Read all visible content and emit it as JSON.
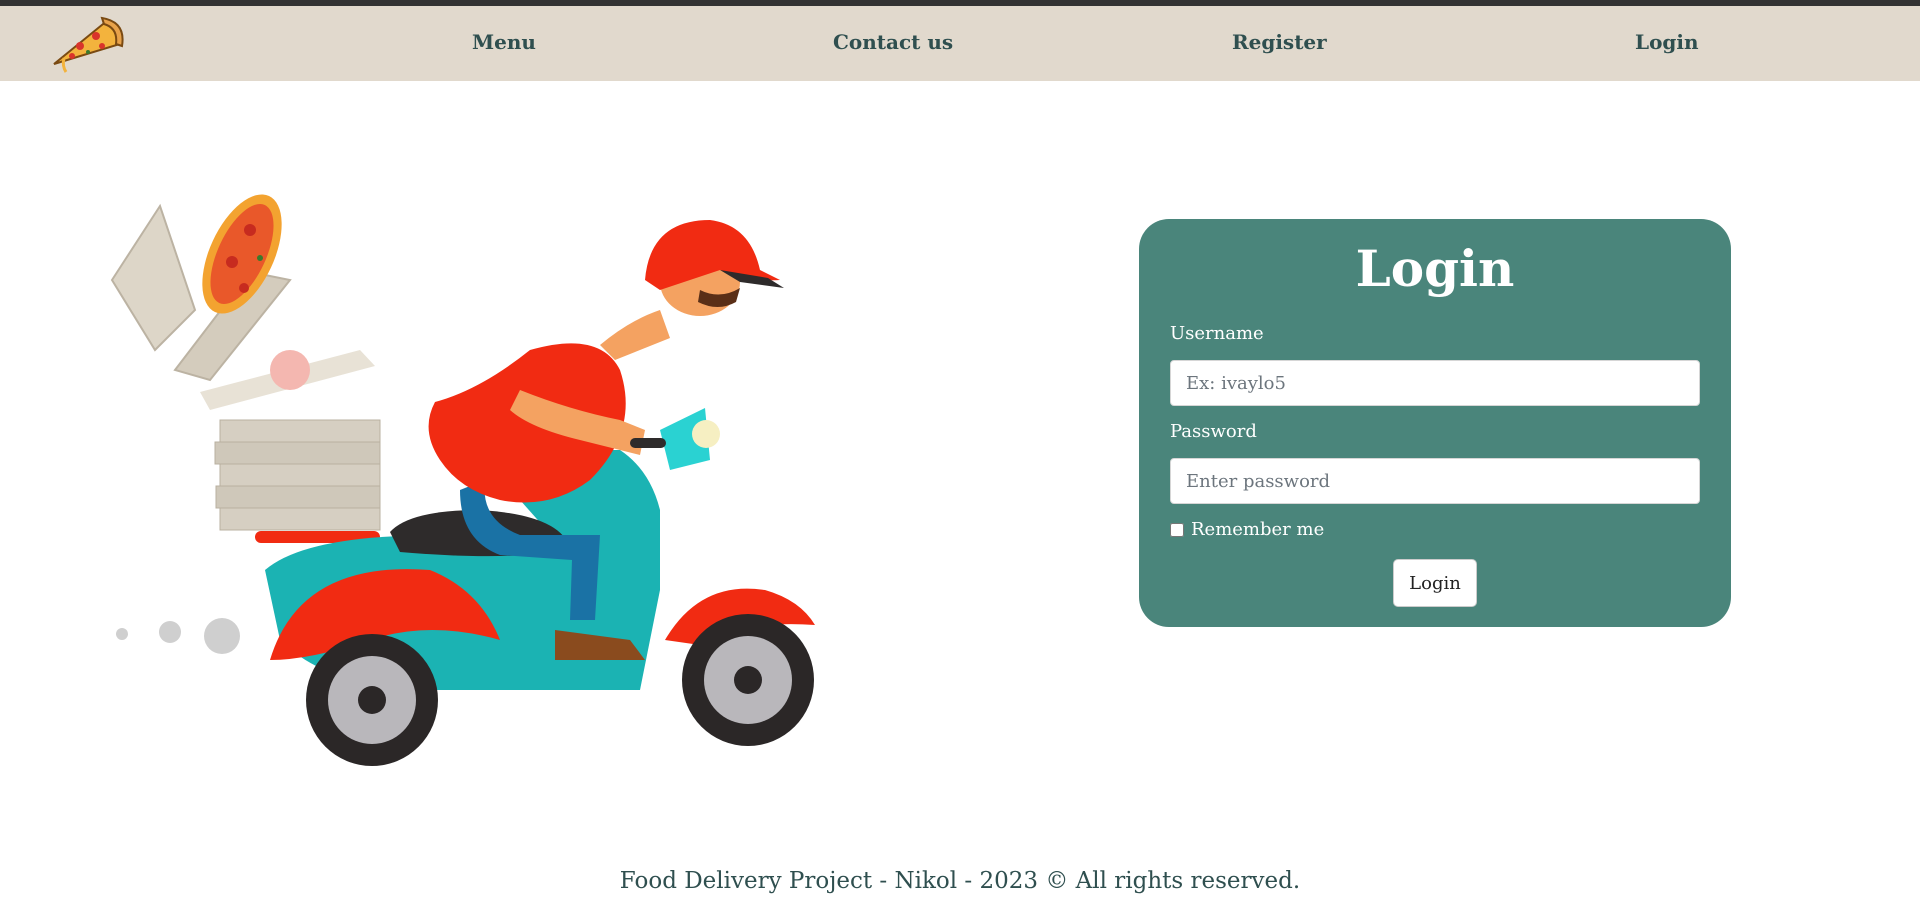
{
  "nav": {
    "items": [
      {
        "label": "Menu"
      },
      {
        "label": "Contact us"
      },
      {
        "label": "Register"
      },
      {
        "label": "Login"
      }
    ]
  },
  "login_form": {
    "title": "Login",
    "username_label": "Username",
    "username_placeholder": "Ex: ivaylo5",
    "password_label": "Password",
    "password_placeholder": "Enter password",
    "remember_label": "Remember me",
    "submit_label": "Login"
  },
  "footer": {
    "text": "Food Delivery Project - Nikol - 2023 © All rights reserved."
  },
  "icons": {
    "logo": "pizza-slice-icon",
    "hero": "delivery-scooter-illustration"
  },
  "colors": {
    "navbar_bg": "#e1d9cd",
    "card_bg": "#4a857b",
    "text_dark": "#2f4f4f"
  }
}
